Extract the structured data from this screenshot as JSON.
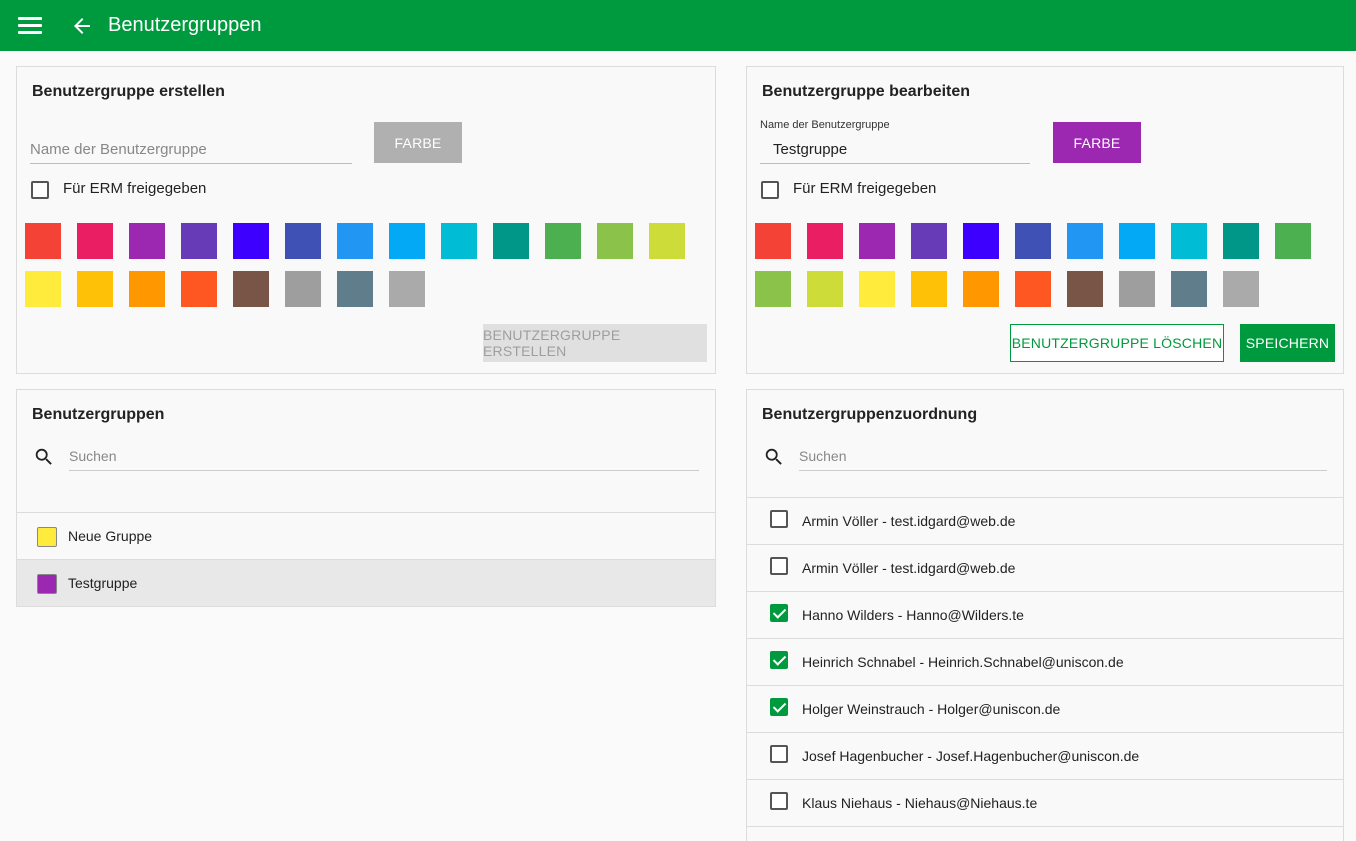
{
  "header": {
    "title": "Benutzergruppen",
    "menu_icon": "menu-icon",
    "back_icon": "arrow-back-icon",
    "color": "#009a3e"
  },
  "create_panel": {
    "title": "Benutzergruppe erstellen",
    "name_placeholder": "Name der Benutzergruppe",
    "name_value": "",
    "color_button": "FARBE",
    "erm_label": "Für ERM freigegeben",
    "erm_checked": false,
    "swatches": [
      "#f44336",
      "#e91e63",
      "#9c27b0",
      "#673ab7",
      "#3d00ff",
      "#3f51b5",
      "#2196f3",
      "#03a9f4",
      "#00bcd4",
      "#009688",
      "#4caf50",
      "#8bc34a",
      "#cddc39",
      "#ffeb3b",
      "#ffc107",
      "#ff9800",
      "#ff5722",
      "#795548",
      "#9e9e9e",
      "#607d8b",
      "#aaaaaa"
    ],
    "submit_button": "BENUTZERGRUPPE ERSTELLEN"
  },
  "edit_panel": {
    "title": "Benutzergruppe bearbeiten",
    "name_label": "Name der Benutzergruppe",
    "name_value": "Testgruppe",
    "color_button": "FARBE",
    "color_button_color": "#9c27b0",
    "erm_label": "Für ERM freigegeben",
    "erm_checked": false,
    "swatches": [
      "#f44336",
      "#e91e63",
      "#9c27b0",
      "#673ab7",
      "#3d00ff",
      "#3f51b5",
      "#2196f3",
      "#03a9f4",
      "#00bcd4",
      "#009688",
      "#4caf50",
      "#8bc34a",
      "#cddc39",
      "#ffeb3b",
      "#ffc107",
      "#ff9800",
      "#ff5722",
      "#795548",
      "#9e9e9e",
      "#607d8b",
      "#aaaaaa"
    ],
    "delete_button": "BENUTZERGRUPPE LÖSCHEN",
    "save_button": "SPEICHERN"
  },
  "groups_panel": {
    "title": "Benutzergruppen",
    "search_placeholder": "Suchen",
    "groups": [
      {
        "name": "Neue Gruppe",
        "color": "#ffeb3b",
        "selected": false
      },
      {
        "name": "Testgruppe",
        "color": "#9c27b0",
        "selected": true
      }
    ]
  },
  "assignment_panel": {
    "title": "Benutzergruppenzuordnung",
    "search_placeholder": "Suchen",
    "users": [
      {
        "label": "Armin Völler - test.idgard@web.de",
        "checked": false
      },
      {
        "label": "Armin Völler - test.idgard@web.de",
        "checked": false
      },
      {
        "label": "Hanno Wilders - Hanno@Wilders.te",
        "checked": true
      },
      {
        "label": "Heinrich Schnabel - Heinrich.Schnabel@uniscon.de",
        "checked": true
      },
      {
        "label": "Holger Weinstrauch - Holger@uniscon.de",
        "checked": true
      },
      {
        "label": "Josef Hagenbucher - Josef.Hagenbucher@uniscon.de",
        "checked": false
      },
      {
        "label": "Klaus Niehaus - Niehaus@Niehaus.te",
        "checked": false
      }
    ]
  }
}
